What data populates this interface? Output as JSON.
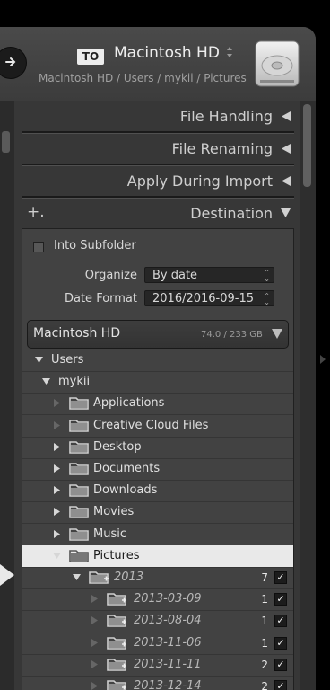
{
  "header": {
    "to_badge": "TO",
    "destination_volume": "Macintosh HD",
    "path": "Macintosh HD / Users / mykii / Pictures",
    "stepper_glyph": "⌃⌄",
    "back_icon": "arrow-right-icon",
    "drive_icon": "hard-drive-icon"
  },
  "sections": {
    "file_handling": "File Handling",
    "file_renaming": "File Renaming",
    "apply_during_import": "Apply During Import",
    "destination": "Destination",
    "add_glyph": "+."
  },
  "destination": {
    "into_subfolder_label": "Into Subfolder",
    "into_subfolder_checked": false,
    "organize_label": "Organize",
    "organize_value": "By date",
    "date_format_label": "Date Format",
    "date_format_value": "2016/2016-09-15",
    "volume_name": "Macintosh HD",
    "volume_usage": "74.0 / 233 GB"
  },
  "tree": {
    "users": "Users",
    "mykii": "mykii",
    "folders": [
      {
        "label": "Applications",
        "has_children": false
      },
      {
        "label": "Creative Cloud Files",
        "has_children": false
      },
      {
        "label": "Desktop",
        "has_children": true
      },
      {
        "label": "Documents",
        "has_children": true
      },
      {
        "label": "Downloads",
        "has_children": true
      },
      {
        "label": "Movies",
        "has_children": true
      },
      {
        "label": "Music",
        "has_children": true
      },
      {
        "label": "Pictures",
        "has_children": true,
        "selected": true
      }
    ],
    "year_folder": {
      "label": "2013",
      "count": "7",
      "checked": true
    },
    "date_folders": [
      {
        "label": "2013-03-09",
        "count": "1",
        "checked": true
      },
      {
        "label": "2013-08-04",
        "count": "1",
        "checked": true
      },
      {
        "label": "2013-11-06",
        "count": "1",
        "checked": true
      },
      {
        "label": "2013-11-11",
        "count": "2",
        "checked": true
      },
      {
        "label": "2013-12-14",
        "count": "2",
        "checked": true
      }
    ],
    "check_glyph": "✓"
  },
  "colors": {
    "panel_bg": "#3a3a3a",
    "selected_row": "#e9e9e9",
    "text": "#e0e0e0"
  }
}
